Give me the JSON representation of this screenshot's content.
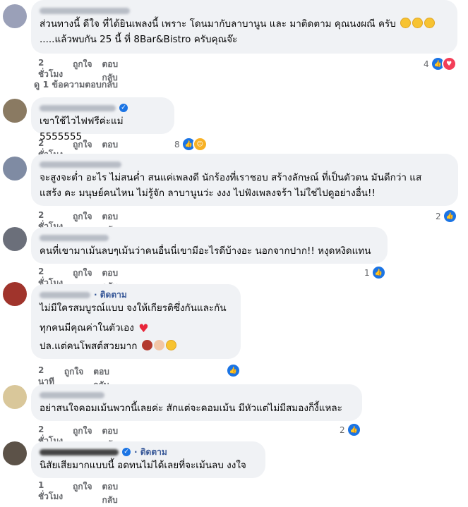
{
  "comments": [
    {
      "text": "ส่วนทางนี้ ดีใจ ที่ได้ยินเพลงนี้ เพราะ โดนมากับลาบานูน และ มาติดตาม คุณนงผณี ครับ",
      "text2": ".....แล้วพบกัน 25 นี้ ที่ 8Bar&Bistro ครับคุณจ๊ะ",
      "time": "2 ชั่วโมง",
      "like": "ถูกใจ",
      "reply": "ตอบกลับ",
      "reaction_count": "4"
    },
    {
      "text": "เขาใช้ไวไฟฟรีค่ะแม่ 5555555",
      "time": "2 ชั่วโมง",
      "like": "ถูกใจ",
      "reply": "ตอบกลับ",
      "reaction_count": "8"
    },
    {
      "text": "จะสูงจะต่ำ อะไร ไม่สนค่ำ สนแค่เพลงดี นักร้องที่เราชอบ สร้างลักษณ์ ที่เป็นตัวตน มันดีกว่า แส",
      "text2": "แสร้ง คะ มนุษย์คนไหน ไม่รู้จัก ลาบานูนว่ะ งงง ไปฟังเพลงจร้า ไม่ใช่ไปดูอย่างอื่น!!",
      "time": "2 ชั่วโมง",
      "like": "ถูกใจ",
      "reply": "ตอบกลับ",
      "reaction_count": "2"
    },
    {
      "text": "คนที่เขามาเม้นลบๆเม้นว่าคนอื่นนี่เขามีอะไรดีบ้างอะ นอกจากปาก!! หงุดหงิดแทน",
      "time": "2 ชั่วโมง",
      "like": "ถูกใจ",
      "reply": "ตอบกลับ",
      "reaction_count": "1"
    },
    {
      "follow": "· ติดตาม",
      "lines": [
        "ไม่มีใครสมบูรณ์แบบ จงให้เกียรติซึ่งกันและกัน",
        "ทุกคนมีคุณค่าในตัวเอง",
        "ปล.แต่คนโพสต์สวยมาก"
      ],
      "time": "2 นาที",
      "like": "ถูกใจ",
      "reply": "ตอบกลับ"
    },
    {
      "text": "อย่าสนใจคอมเม้นพวกนี้เลยค่ะ สักแต่จะคอมเม้น มีหัวแต่ไม่มีสมองก็งี้แหละ",
      "time": "2 ชั่วโมง",
      "like": "ถูกใจ",
      "reply": "ตอบกลับ",
      "reaction_count": "2"
    },
    {
      "follow": "· ติดตาม",
      "text": "นิสัยเสียมากแบบนี้ อดทนไม่ได้เลยที่จะเม้นลบ งงใจ",
      "time": "1 ชั่วโมง",
      "like": "ถูกใจ",
      "reply": "ตอบกลับ"
    }
  ],
  "view_replies": "ดู 1 ข้อความตอบกลับ",
  "colors": {
    "bubble": "#f0f2f5",
    "link": "#385898",
    "like_blue": "#1b74e4",
    "meta_gray": "#65676b"
  }
}
